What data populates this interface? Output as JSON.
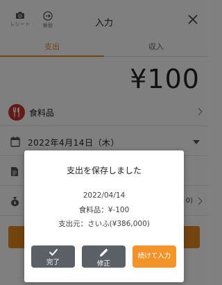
{
  "header": {
    "receipt_label": "レシート",
    "parcel_label": "餐替",
    "title": "入力"
  },
  "tabs": [
    {
      "label": "支出",
      "active": true
    },
    {
      "label": "収入",
      "active": false
    }
  ],
  "amount": "¥100",
  "category": {
    "label": "食料品"
  },
  "date": {
    "label": "2022年4月14日（木）"
  },
  "wallet": {
    "tail": "0)"
  },
  "colors": {
    "accent": "#e8891e",
    "category_red": "#c8342c",
    "modal_button_gray": "#5b6066",
    "continue_orange": "#f2942a"
  },
  "modal": {
    "title": "支出を保存しました",
    "date": "2022/04/14",
    "category_line": "食料品：¥-100",
    "source_line": "支出元：さいふ(¥386,000)",
    "buttons": {
      "done": "完了",
      "edit": "修正",
      "continue": "続けて入力"
    }
  },
  "icons": [
    "camera-icon",
    "parcel-icon",
    "close-icon",
    "utensils-icon",
    "chevron-right-icon",
    "calendar-icon",
    "caret-down-icon",
    "document-icon",
    "money-bag-icon",
    "check-icon",
    "pencil-icon"
  ]
}
